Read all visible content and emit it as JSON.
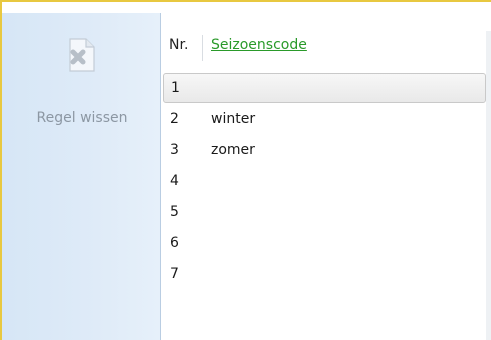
{
  "toolbar": {
    "delete_row_label": "Regel wissen",
    "delete_row_icon": "document-delete-icon"
  },
  "grid": {
    "columns": [
      "Nr.",
      "Seizoenscode"
    ],
    "rows": [
      {
        "nr": "1",
        "code": ""
      },
      {
        "nr": "2",
        "code": "winter"
      },
      {
        "nr": "3",
        "code": "zomer"
      },
      {
        "nr": "4",
        "code": ""
      },
      {
        "nr": "5",
        "code": ""
      },
      {
        "nr": "6",
        "code": ""
      },
      {
        "nr": "7",
        "code": ""
      }
    ],
    "selected_row": 1
  },
  "colors": {
    "frame_border": "#e8c840",
    "sidebar_bg": "#dfebf8",
    "link_header": "#2a9a2a"
  }
}
